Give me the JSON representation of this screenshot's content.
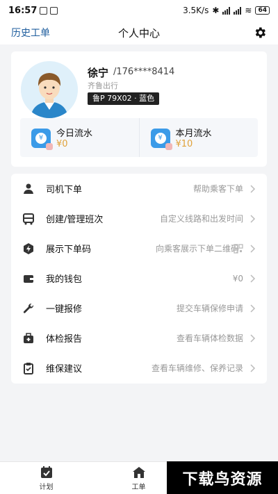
{
  "status_bar": {
    "time": "16:57",
    "network_speed": "3.5K/s",
    "battery": "64"
  },
  "header": {
    "history_label": "历史工单",
    "title": "个人中心"
  },
  "profile": {
    "name": "徐宁",
    "phone": "/176****8414",
    "company": "齐鲁出行",
    "plate": "鲁P 79X02 · 蓝色"
  },
  "stats": [
    {
      "label": "今日流水",
      "value": "¥0"
    },
    {
      "label": "本月流水",
      "value": "¥10"
    }
  ],
  "menu": [
    {
      "label": "司机下单",
      "desc": "帮助乘客下单",
      "icon": "driver-icon"
    },
    {
      "label": "创建/管理班次",
      "desc": "自定义线路和出发时间",
      "icon": "bus-icon"
    },
    {
      "label": "展示下单码",
      "desc": "向乘客展示下单二维码",
      "icon": "flash-code-icon"
    },
    {
      "label": "我的钱包",
      "desc": "¥0",
      "icon": "wallet-icon"
    },
    {
      "label": "一键报修",
      "desc": "提交车辆保修申请",
      "icon": "wrench-icon"
    },
    {
      "label": "体检报告",
      "desc": "查看车辆体检数据",
      "icon": "medical-kit-icon"
    },
    {
      "label": "维保建议",
      "desc": "查看车辆维修、保养记录",
      "icon": "clipboard-icon"
    }
  ],
  "bottom_nav": [
    {
      "label": "计划",
      "icon": "calendar-check-icon"
    },
    {
      "label": "工单",
      "icon": "home-icon"
    }
  ],
  "watermark": "下载鸟资源",
  "colors": {
    "accent": "#1f5e9e",
    "amount": "#e0a23a",
    "stat_icon": "#3b9be8"
  }
}
